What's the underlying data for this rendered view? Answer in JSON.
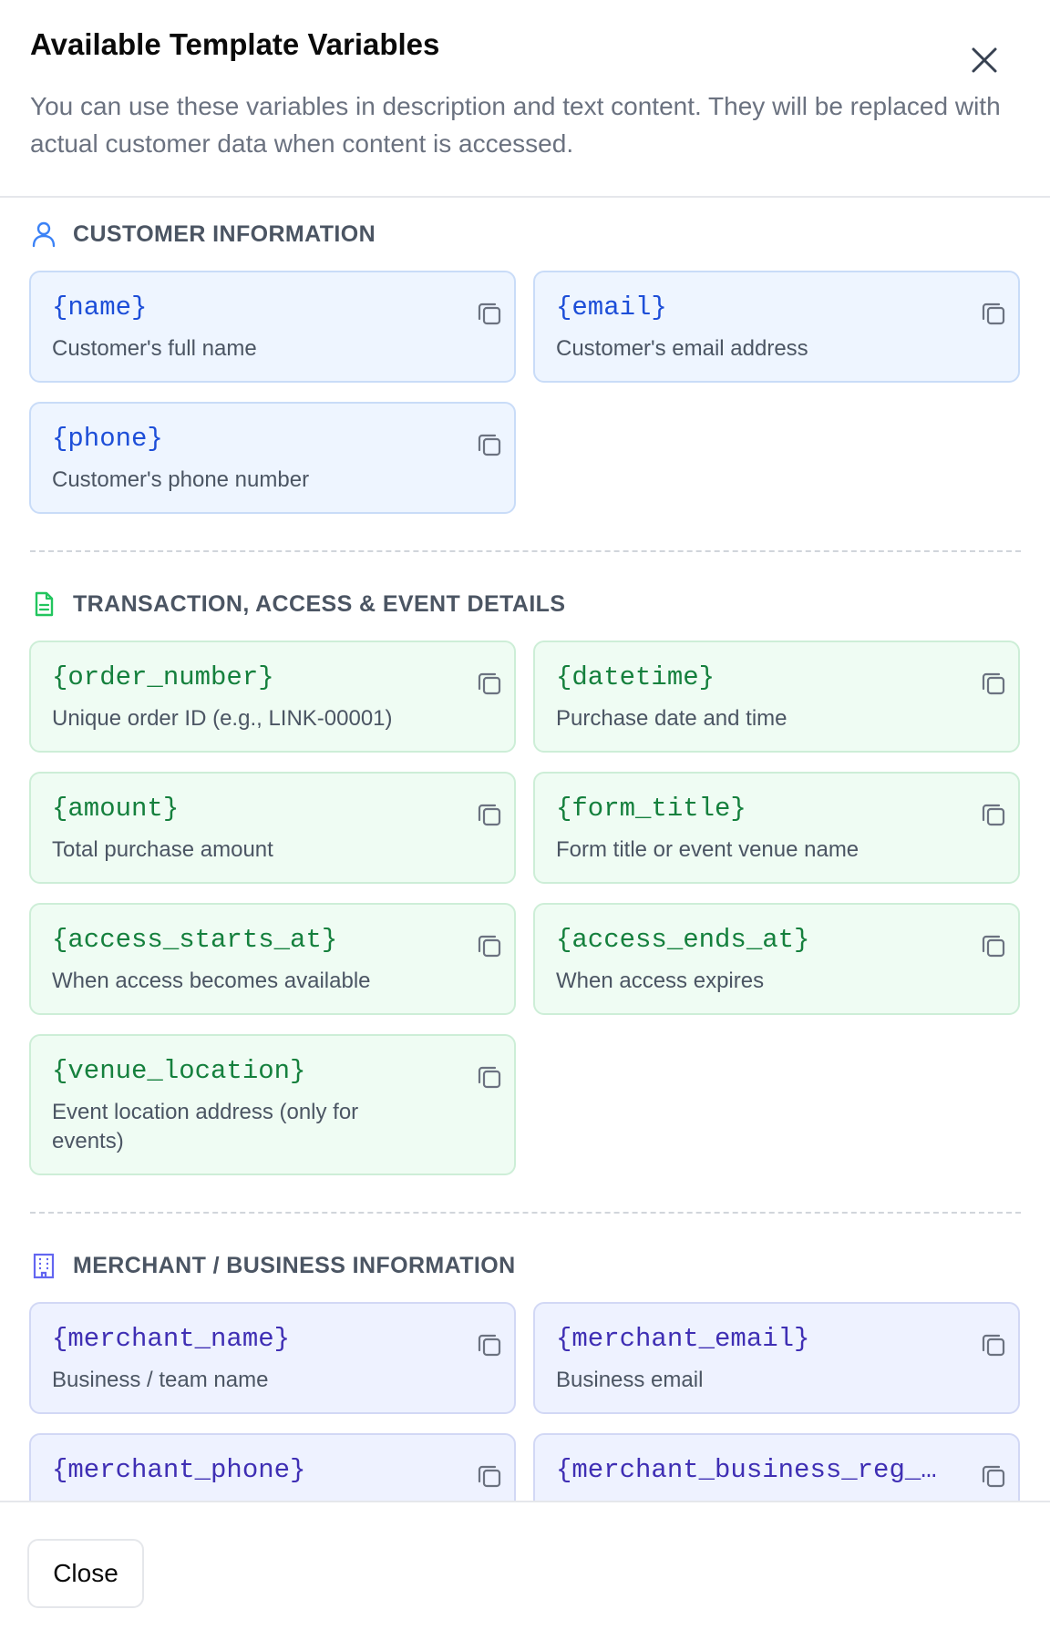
{
  "dialog": {
    "title": "Available Template Variables",
    "subtitle": "You can use these variables in description and text content. They will be replaced with actual customer data when content is accessed.",
    "close_icon": "close-icon"
  },
  "sections": {
    "customer": {
      "title": "CUSTOMER INFORMATION",
      "icon": "user-icon",
      "color": "#3b82f6",
      "items": [
        {
          "var": "{name}",
          "desc": "Customer's full name"
        },
        {
          "var": "{email}",
          "desc": "Customer's email address"
        },
        {
          "var": "{phone}",
          "desc": "Customer's phone number"
        }
      ]
    },
    "transaction": {
      "title": "TRANSACTION, ACCESS & EVENT DETAILS",
      "icon": "document-icon",
      "color": "#22c55e",
      "items": [
        {
          "var": "{order_number}",
          "desc": "Unique order ID (e.g., LINK-00001)"
        },
        {
          "var": "{datetime}",
          "desc": "Purchase date and time"
        },
        {
          "var": "{amount}",
          "desc": "Total purchase amount"
        },
        {
          "var": "{form_title}",
          "desc": "Form title or event venue name"
        },
        {
          "var": "{access_starts_at}",
          "desc": "When access becomes available"
        },
        {
          "var": "{access_ends_at}",
          "desc": "When access expires"
        },
        {
          "var": "{venue_location}",
          "desc": "Event location address (only for events)"
        }
      ]
    },
    "merchant": {
      "title": "MERCHANT / BUSINESS INFORMATION",
      "icon": "building-icon",
      "color": "#6366f1",
      "items": [
        {
          "var": "{merchant_name}",
          "desc": "Business / team name"
        },
        {
          "var": "{merchant_email}",
          "desc": "Business email"
        },
        {
          "var": "{merchant_phone}",
          "desc": ""
        },
        {
          "var": "{merchant_business_reg_n...",
          "desc": ""
        }
      ]
    }
  },
  "copy_icon": "copy-icon",
  "footer": {
    "close_label": "Close"
  }
}
